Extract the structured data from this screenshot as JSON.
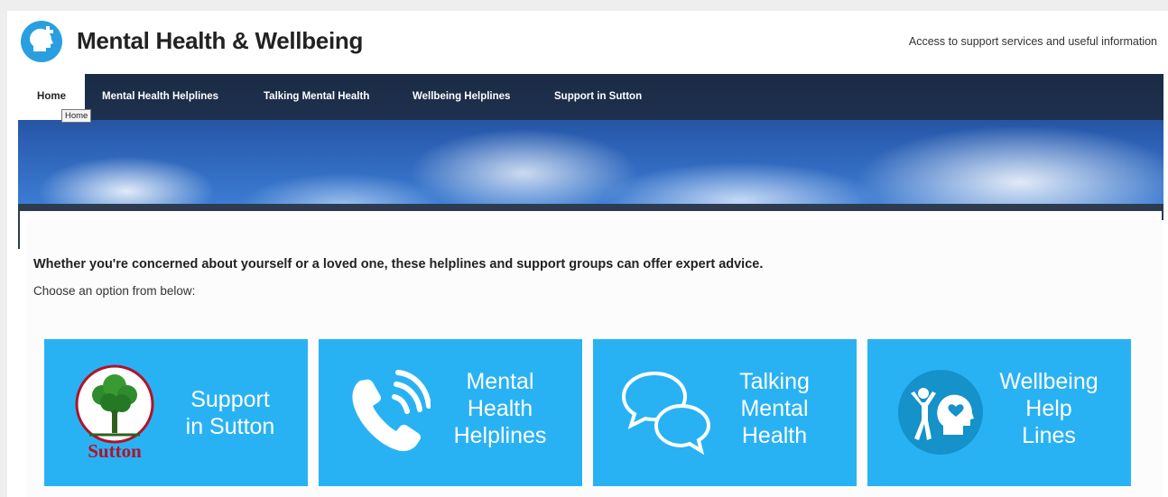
{
  "header": {
    "title": "Mental Health & Wellbeing",
    "tagline": "Access to support services and useful information",
    "logo_icon": "head-plus-icon"
  },
  "nav": {
    "items": [
      {
        "label": "Home",
        "active": true
      },
      {
        "label": "Mental Health Helplines",
        "active": false
      },
      {
        "label": "Talking Mental Health",
        "active": false
      },
      {
        "label": "Wellbeing Helplines",
        "active": false
      },
      {
        "label": "Support in Sutton",
        "active": false
      }
    ],
    "tooltip": "Home"
  },
  "main": {
    "intro": "Whether you're concerned about yourself or a loved one, these helplines and support groups can offer expert advice.",
    "choose": "Choose an option from below:"
  },
  "tiles": [
    {
      "line1": "Support",
      "line2": "in Sutton",
      "line3": "",
      "icon": "sutton-tree-logo",
      "logo_text": "Sutton"
    },
    {
      "line1": "Mental",
      "line2": "Health",
      "line3": "Helplines",
      "icon": "phone-icon"
    },
    {
      "line1": "Talking",
      "line2": "Mental",
      "line3": "Health",
      "icon": "speech-bubbles-icon"
    },
    {
      "line1": "Wellbeing",
      "line2": "Help",
      "line3": "Lines",
      "icon": "person-head-heart-icon"
    }
  ],
  "colors": {
    "tile": "#29b2f3",
    "nav": "#1c283a",
    "logo": "#2a9fe0",
    "sutton_red": "#b0132a",
    "sutton_green": "#2e8b2e"
  }
}
